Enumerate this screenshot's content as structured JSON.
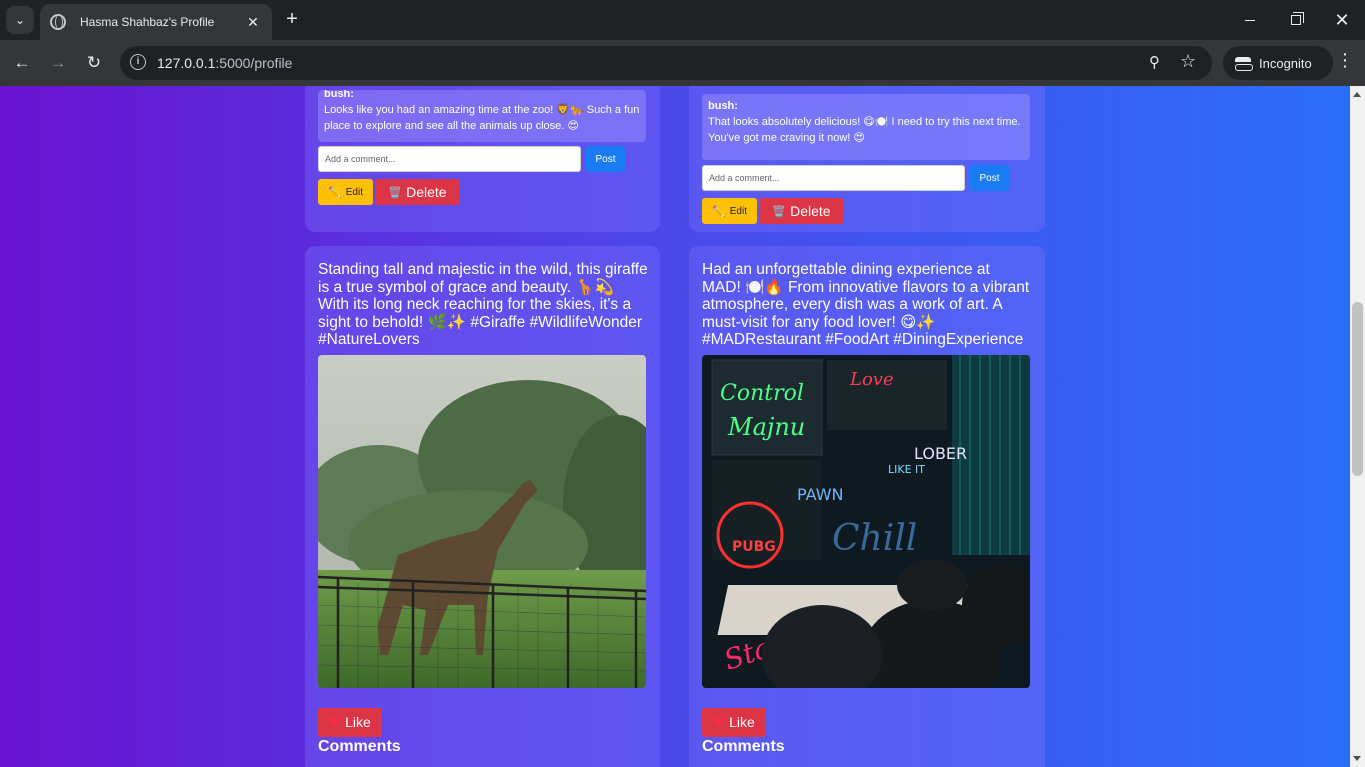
{
  "browser": {
    "tab_title": "Hasma Shahbaz's Profile",
    "url_host": "127.0.0.1",
    "url_path": ":5000/profile",
    "incognito_label": "Incognito"
  },
  "posts_top": [
    {
      "comment_author": "bush:",
      "comment_text": "Looks like you had an amazing time at the zoo! 🦁🐆 Such a fun place to explore and see all the animals up close. 😍",
      "comment_placeholder": "Add a comment...",
      "post_label": "Post",
      "edit_label": "Edit",
      "delete_label": "Delete"
    },
    {
      "comment_author": "bush:",
      "comment_text": "That looks absolutely delicious! 😋🍽️ I need to try this next time. You've got me craving it now! 😍",
      "comment_placeholder": "Add a comment...",
      "post_label": "Post",
      "edit_label": "Edit",
      "delete_label": "Delete"
    }
  ],
  "posts": [
    {
      "text": "Standing tall and majestic in the wild, this giraffe is a true symbol of grace and beauty. 🦒💫 With its long neck reaching for the skies, it's a sight to behold! 🌿✨ #Giraffe #WildlifeWonder #NatureLovers",
      "image": "giraffe-photo",
      "like_label": "Like",
      "comments_heading": "Comments"
    },
    {
      "text": "Had an unforgettable dining experience at MAD! 🍽️🔥 From innovative flavors to a vibrant atmosphere, every dish was a work of art. A must-visit for any food lover! 😋✨ #MADRestaurant #FoodArt #DiningExperience",
      "image": "neon-restaurant-photo",
      "like_label": "Like",
      "comments_heading": "Comments"
    }
  ],
  "neon_signs": [
    "Control",
    "Majnu",
    "Love",
    "PUBG",
    "LOBER",
    "Chill",
    "PAWN",
    "LIKE IT",
    "Star"
  ]
}
